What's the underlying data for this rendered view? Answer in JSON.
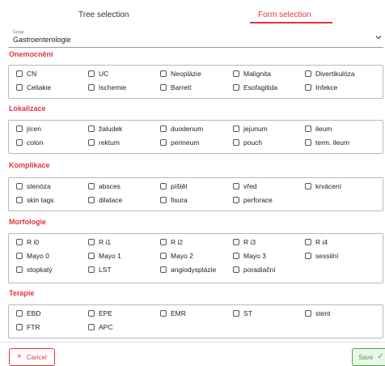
{
  "tabs": {
    "tree_label": "Tree selection",
    "form_label": "Form selection"
  },
  "group": {
    "label": "Group",
    "value": "Gastroenterologie",
    "icon": "chevron-down-icon"
  },
  "sections": [
    {
      "title": "Onemocnění",
      "options": [
        "CN",
        "UC",
        "Neoplázie",
        "Malignita",
        "Divertikulóza",
        "Celiakie",
        "Ischemie",
        "Barrett",
        "Esofagitida",
        "Infekce"
      ]
    },
    {
      "title": "Lokalizace",
      "options": [
        "jícen",
        "žaludek",
        "duodenum",
        "jejunum",
        "ileum",
        "colon",
        "rektum",
        "perineum",
        "pouch",
        "term. ileum"
      ]
    },
    {
      "title": "Komplikace",
      "options": [
        "stenóza",
        "absces",
        "píštěl",
        "vřed",
        "krvácení",
        "skin tags",
        "dilatace",
        "fisura",
        "perforace"
      ]
    },
    {
      "title": "Morfologie",
      "options": [
        "R i0",
        "R i1",
        "R i2",
        "R i3",
        "R i4",
        "Mayo 0",
        "Mayo 1",
        "Mayo 2",
        "Mayo 3",
        "sessilní",
        "stopkatý",
        "LST",
        "angiodysplázie",
        "poradiační"
      ]
    },
    {
      "title": "Terapie",
      "options": [
        "EBD",
        "EPE",
        "EMR",
        "ST",
        "stent",
        "FTR",
        "APC"
      ]
    }
  ],
  "buttons": {
    "cancel_label": "Cancel",
    "save_label": "Save"
  },
  "colors": {
    "accent": "#e0353f",
    "save": "#49a84a"
  }
}
